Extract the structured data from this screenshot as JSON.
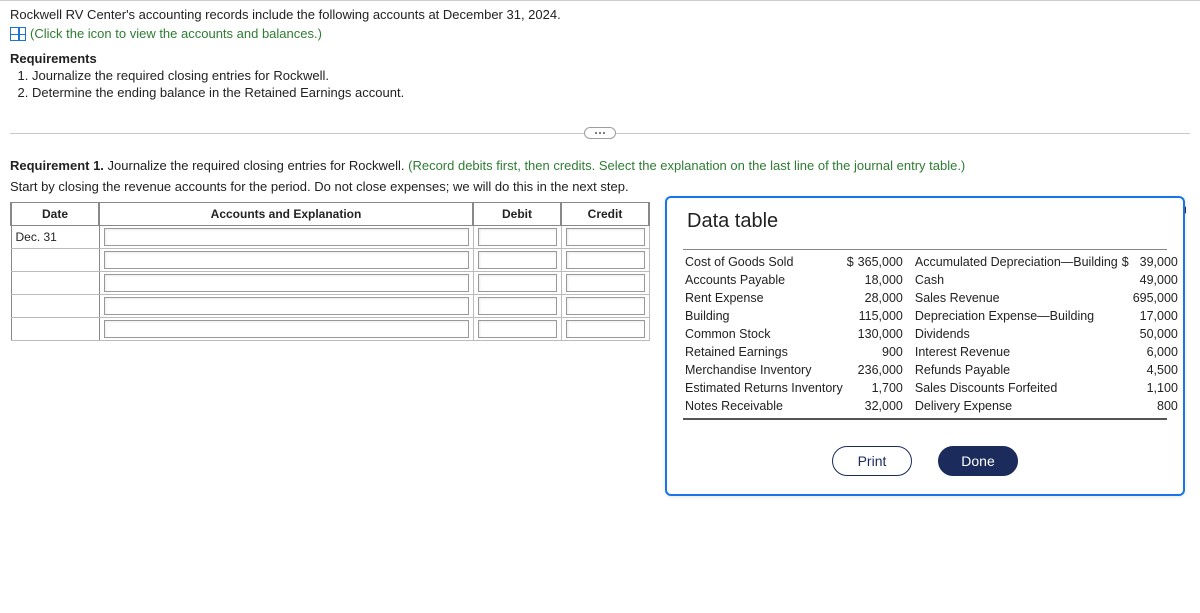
{
  "intro": "Rockwell RV Center's accounting records include the following accounts at December 31, 2024.",
  "click_icon_text": "(Click the icon to view the accounts and balances.)",
  "requirements_heading": "Requirements",
  "requirements": [
    "Journalize the required closing entries for Rockwell.",
    "Determine the ending balance in the Retained Earnings account."
  ],
  "req1_bold": "Requirement 1.",
  "req1_text": " Journalize the required closing entries for Rockwell. ",
  "req1_green": "(Record debits first, then credits. Select the explanation on the last line of the journal entry table.)",
  "start_text": "Start by closing the revenue accounts for the period. Do not close expenses; we will do this in the next step.",
  "journal_headers": {
    "date": "Date",
    "accounts": "Accounts and Explanation",
    "debit": "Debit",
    "credit": "Credit"
  },
  "journal_date": "Dec. 31",
  "modal_title": "Data table",
  "data_rows": [
    {
      "l1": "Cost of Goods Sold",
      "c1": "$",
      "a1": "365,000",
      "l2": "Accumulated Depreciation—Building",
      "c2": "$",
      "a2": "39,000"
    },
    {
      "l1": "Accounts Payable",
      "c1": "",
      "a1": "18,000",
      "l2": "Cash",
      "c2": "",
      "a2": "49,000"
    },
    {
      "l1": "Rent Expense",
      "c1": "",
      "a1": "28,000",
      "l2": "Sales Revenue",
      "c2": "",
      "a2": "695,000"
    },
    {
      "l1": "Building",
      "c1": "",
      "a1": "115,000",
      "l2": "Depreciation Expense—Building",
      "c2": "",
      "a2": "17,000"
    },
    {
      "l1": "Common Stock",
      "c1": "",
      "a1": "130,000",
      "l2": "Dividends",
      "c2": "",
      "a2": "50,000"
    },
    {
      "l1": "Retained Earnings",
      "c1": "",
      "a1": "900",
      "l2": "Interest Revenue",
      "c2": "",
      "a2": "6,000"
    },
    {
      "l1": "Merchandise Inventory",
      "c1": "",
      "a1": "236,000",
      "l2": "Refunds Payable",
      "c2": "",
      "a2": "4,500"
    },
    {
      "l1": "Estimated Returns Inventory",
      "c1": "",
      "a1": "1,700",
      "l2": "Sales Discounts Forfeited",
      "c2": "",
      "a2": "1,100"
    },
    {
      "l1": "Notes Receivable",
      "c1": "",
      "a1": "32,000",
      "l2": "Delivery Expense",
      "c2": "",
      "a2": "800"
    }
  ],
  "buttons": {
    "print": "Print",
    "done": "Done"
  }
}
